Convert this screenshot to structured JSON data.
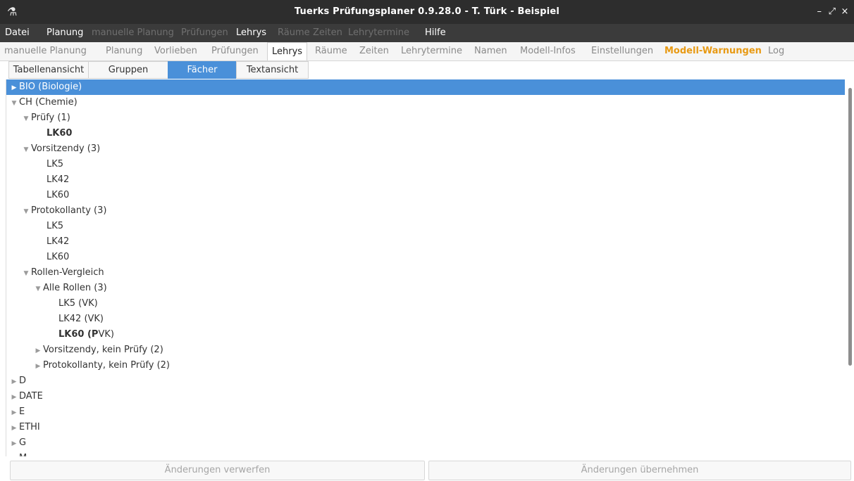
{
  "window": {
    "title": "Tuerks Prüfungsplaner 0.9.28.0 - T. Türk - Beispiel",
    "app_icon": "flask-icon",
    "controls": [
      "–",
      "⤢",
      "×"
    ]
  },
  "menubar": {
    "items": [
      {
        "label": "Datei",
        "enabled": true
      },
      {
        "label": "Planung",
        "enabled": true
      },
      {
        "label": "manuelle Planung",
        "enabled": false
      },
      {
        "label": "Prüfungen",
        "enabled": false
      },
      {
        "label": "Lehrys",
        "enabled": true
      },
      {
        "label": "Räume",
        "enabled": false
      },
      {
        "label": "Zeiten",
        "enabled": false
      },
      {
        "label": "Lehrytermine",
        "enabled": false
      },
      {
        "label": "Hilfe",
        "enabled": true
      }
    ]
  },
  "tabs": {
    "items": [
      {
        "label": "manuelle Planung"
      },
      {
        "label": "Planung"
      },
      {
        "label": "Vorlieben"
      },
      {
        "label": "Prüfungen"
      },
      {
        "label": "Lehrys",
        "active": true
      },
      {
        "label": "Räume"
      },
      {
        "label": "Zeiten"
      },
      {
        "label": "Lehrytermine"
      },
      {
        "label": "Namen"
      },
      {
        "label": "Modell-Infos"
      },
      {
        "label": "Einstellungen"
      },
      {
        "label": "Modell-Warnungen",
        "warning": true
      },
      {
        "label": "Log"
      }
    ],
    "warning_color": "#e89a14"
  },
  "subtabs": {
    "items": [
      {
        "label": "Tabellenansicht"
      },
      {
        "label": "Gruppen"
      },
      {
        "label": "Fächer",
        "active": true
      },
      {
        "label": "Textansicht"
      }
    ],
    "active_color": "#4a90d9"
  },
  "tree": {
    "rows": [
      {
        "label": "BIO (Biologie)",
        "state": "collapsed",
        "selected": true
      },
      {
        "label": "CH (Chemie)",
        "state": "expanded"
      },
      {
        "label": "Prüfy (1)",
        "state": "expanded"
      },
      {
        "label": "LK60",
        "state": "leaf",
        "bold": true
      },
      {
        "label": "Vorsitzendy (3)",
        "state": "expanded"
      },
      {
        "label": "LK5",
        "state": "leaf"
      },
      {
        "label": "LK42",
        "state": "leaf"
      },
      {
        "label": "LK60",
        "state": "leaf"
      },
      {
        "label": "Protokollanty (3)",
        "state": "expanded"
      },
      {
        "label": "LK5",
        "state": "leaf"
      },
      {
        "label": "LK42",
        "state": "leaf"
      },
      {
        "label": "LK60",
        "state": "leaf"
      },
      {
        "label": "Rollen-Vergleich",
        "state": "expanded"
      },
      {
        "label": "Alle Rollen (3)",
        "state": "expanded"
      },
      {
        "label": "LK5 (VK)",
        "state": "leaf"
      },
      {
        "label": "LK42 (VK)",
        "state": "leaf"
      },
      {
        "label": "LK60 (PVK)",
        "state": "leaf",
        "bold_prefix": "LK60 (P",
        "rest": "VK)"
      },
      {
        "label": "Vorsitzendy, kein Prüfy (2)",
        "state": "collapsed"
      },
      {
        "label": "Protokollanty, kein Prüfy (2)",
        "state": "collapsed"
      },
      {
        "label": "D",
        "state": "collapsed"
      },
      {
        "label": "DATE",
        "state": "collapsed"
      },
      {
        "label": "E",
        "state": "collapsed"
      },
      {
        "label": "ETHI",
        "state": "collapsed"
      },
      {
        "label": "G",
        "state": "collapsed"
      },
      {
        "label": "M",
        "state": "collapsed"
      }
    ],
    "selection_color": "#4a90d9"
  },
  "buttons": {
    "discard": "Änderungen verwerfen",
    "apply": "Änderungen übernehmen"
  }
}
